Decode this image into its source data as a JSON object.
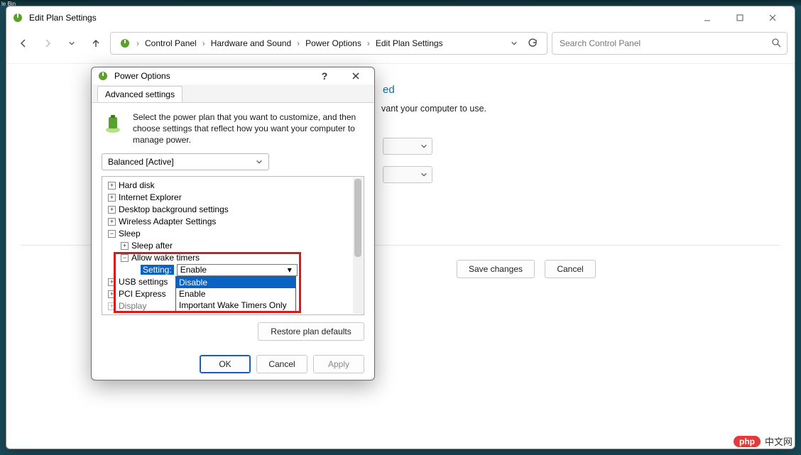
{
  "desktop_icon_label": "le Bin",
  "explorer": {
    "title": "Edit Plan Settings",
    "breadcrumbs": [
      "Control Panel",
      "Hardware and Sound",
      "Power Options",
      "Edit Plan Settings"
    ],
    "search_placeholder": "Search Control Panel",
    "partial_subtext": "vant your computer to use.",
    "partial_heading_suffix": "ed",
    "save_btn": "Save changes",
    "cancel_btn": "Cancel"
  },
  "dialog": {
    "title": "Power Options",
    "tab": "Advanced settings",
    "intro": "Select the power plan that you want to customize, and then choose settings that reflect how you want your computer to manage power.",
    "plan": "Balanced [Active]",
    "tree": {
      "hard_disk": "Hard disk",
      "ie": "Internet Explorer",
      "desktop_bg": "Desktop background settings",
      "wifi": "Wireless Adapter Settings",
      "sleep": "Sleep",
      "sleep_after": "Sleep after",
      "wake_timers": "Allow wake timers",
      "setting_label": "Setting:",
      "setting_value": "Enable",
      "usb": "USB settings",
      "pci": "PCI Express",
      "display": "Display"
    },
    "dropdown": {
      "opt1": "Disable",
      "opt2": "Enable",
      "opt3": "Important Wake Timers Only"
    },
    "restore": "Restore plan defaults",
    "ok": "OK",
    "cancel": "Cancel",
    "apply": "Apply"
  },
  "watermark": {
    "pill": "php",
    "text": "中文网"
  }
}
